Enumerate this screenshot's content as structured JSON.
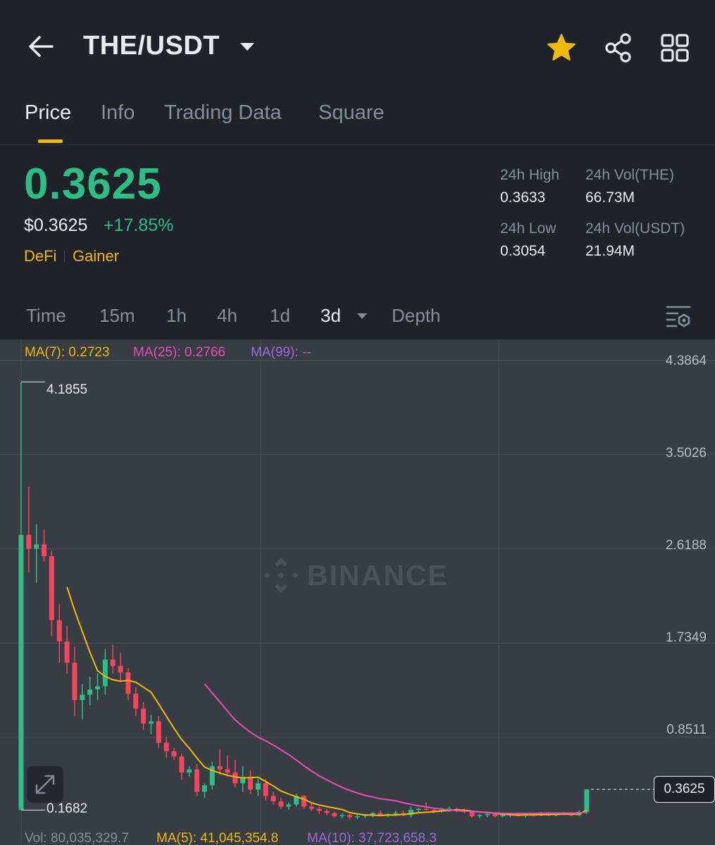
{
  "header": {
    "pair": "THE/USDT",
    "back_icon": "back-arrow-icon",
    "favorite_icon": "star-icon",
    "share_icon": "share-icon",
    "menu_icon": "grid-icon",
    "favorite_color": "#f0b90b"
  },
  "tabs": [
    {
      "label": "Price",
      "active": true
    },
    {
      "label": "Info",
      "active": false
    },
    {
      "label": "Trading Data",
      "active": false
    },
    {
      "label": "Square",
      "active": false
    }
  ],
  "price": {
    "last": "0.3625",
    "usd": "$0.3625",
    "change": "+17.85%",
    "tags": [
      "DeFi",
      "Gainer"
    ],
    "up_color": "#2ebd85",
    "down_color": "#f6465d",
    "accent_color": "#f0b90b"
  },
  "stats": {
    "high_label": "24h High",
    "high": "0.3633",
    "low_label": "24h Low",
    "low": "0.3054",
    "vol_base_label": "24h Vol(THE)",
    "vol_base": "66.73M",
    "vol_quote_label": "24h Vol(USDT)",
    "vol_quote": "21.94M"
  },
  "intervals": {
    "items": [
      "Time",
      "15m",
      "1h",
      "4h",
      "1d",
      "3d",
      "Depth"
    ],
    "active": "3d",
    "settings_icon": "chart-settings-icon"
  },
  "chart": {
    "ma7": "MA(7): 0.2723",
    "ma25": "MA(25): 0.2766",
    "ma99": "MA(99): --",
    "y_ticks": [
      "4.3864",
      "3.5026",
      "2.6188",
      "1.7349",
      "0.8511"
    ],
    "high_marker": "4.1855",
    "low_marker": "0.1682",
    "current_price": "0.3625",
    "watermark": "BINANCE",
    "vol": "Vol: 80,035,329.7",
    "vol_ma5": "MA(5): 41,045,354.8",
    "vol_ma10": "MA(10): 37,723,658.3",
    "ma7_color": "#f0b90b",
    "ma25_color": "#e84dbe",
    "ma99_color": "#9c6ade",
    "expand_icon": "expand-icon"
  },
  "chart_data": {
    "type": "candlestick",
    "y_range": [
      0.0,
      4.3864
    ],
    "y_ticks": [
      4.3864,
      3.5026,
      2.6188,
      1.7349,
      0.8511
    ],
    "grid": true,
    "candles": [
      [
        0.17,
        4.1855,
        0.1682,
        2.75
      ],
      [
        2.75,
        3.2,
        2.4,
        2.62
      ],
      [
        2.62,
        2.85,
        2.3,
        2.66
      ],
      [
        2.66,
        2.8,
        2.5,
        2.55
      ],
      [
        2.55,
        2.6,
        1.8,
        1.95
      ],
      [
        1.95,
        2.1,
        1.55,
        1.75
      ],
      [
        1.75,
        1.9,
        1.45,
        1.55
      ],
      [
        1.55,
        1.7,
        1.05,
        1.2
      ],
      [
        1.2,
        1.35,
        1.02,
        1.25
      ],
      [
        1.25,
        1.42,
        1.15,
        1.3
      ],
      [
        1.3,
        1.45,
        1.2,
        1.33
      ],
      [
        1.33,
        1.68,
        1.25,
        1.58
      ],
      [
        1.58,
        1.72,
        1.45,
        1.52
      ],
      [
        1.52,
        1.64,
        1.38,
        1.46
      ],
      [
        1.46,
        1.5,
        1.2,
        1.26
      ],
      [
        1.26,
        1.32,
        1.05,
        1.12
      ],
      [
        1.12,
        1.18,
        0.92,
        0.98
      ],
      [
        0.98,
        1.06,
        0.88,
        1.0
      ],
      [
        1.0,
        1.05,
        0.75,
        0.8
      ],
      [
        0.8,
        0.85,
        0.66,
        0.72
      ],
      [
        0.72,
        0.75,
        0.64,
        0.67
      ],
      [
        0.67,
        0.7,
        0.45,
        0.52
      ],
      [
        0.52,
        0.58,
        0.48,
        0.55
      ],
      [
        0.55,
        0.6,
        0.3,
        0.34
      ],
      [
        0.34,
        0.42,
        0.28,
        0.4
      ],
      [
        0.4,
        0.62,
        0.36,
        0.58
      ],
      [
        0.58,
        0.74,
        0.5,
        0.55
      ],
      [
        0.55,
        0.68,
        0.48,
        0.52
      ],
      [
        0.52,
        0.64,
        0.38,
        0.42
      ],
      [
        0.42,
        0.58,
        0.34,
        0.48
      ],
      [
        0.48,
        0.54,
        0.32,
        0.36
      ],
      [
        0.36,
        0.46,
        0.3,
        0.42
      ],
      [
        0.42,
        0.46,
        0.26,
        0.3
      ],
      [
        0.3,
        0.34,
        0.22,
        0.25
      ],
      [
        0.25,
        0.28,
        0.18,
        0.2
      ],
      [
        0.2,
        0.24,
        0.17,
        0.22
      ],
      [
        0.22,
        0.32,
        0.2,
        0.3
      ],
      [
        0.3,
        0.31,
        0.18,
        0.2
      ],
      [
        0.2,
        0.23,
        0.16,
        0.18
      ],
      [
        0.18,
        0.2,
        0.13,
        0.16
      ],
      [
        0.16,
        0.18,
        0.12,
        0.14
      ],
      [
        0.14,
        0.15,
        0.1,
        0.11
      ],
      [
        0.11,
        0.14,
        0.09,
        0.12
      ],
      [
        0.12,
        0.13,
        0.08,
        0.1
      ],
      [
        0.1,
        0.12,
        0.08,
        0.11
      ],
      [
        0.11,
        0.13,
        0.09,
        0.12
      ],
      [
        0.12,
        0.15,
        0.1,
        0.14
      ],
      [
        0.14,
        0.16,
        0.11,
        0.12
      ],
      [
        0.12,
        0.14,
        0.1,
        0.13
      ],
      [
        0.13,
        0.16,
        0.11,
        0.14
      ],
      [
        0.14,
        0.16,
        0.11,
        0.12
      ],
      [
        0.12,
        0.2,
        0.1,
        0.17
      ],
      [
        0.17,
        0.19,
        0.14,
        0.18
      ],
      [
        0.18,
        0.24,
        0.16,
        0.17
      ],
      [
        0.17,
        0.19,
        0.14,
        0.16
      ],
      [
        0.16,
        0.19,
        0.14,
        0.17
      ],
      [
        0.17,
        0.2,
        0.15,
        0.18
      ],
      [
        0.18,
        0.19,
        0.15,
        0.16
      ],
      [
        0.16,
        0.18,
        0.14,
        0.15
      ],
      [
        0.15,
        0.16,
        0.1,
        0.11
      ],
      [
        0.11,
        0.13,
        0.09,
        0.12
      ],
      [
        0.12,
        0.14,
        0.1,
        0.13
      ],
      [
        0.13,
        0.14,
        0.1,
        0.11
      ],
      [
        0.11,
        0.13,
        0.1,
        0.12
      ],
      [
        0.12,
        0.14,
        0.1,
        0.13
      ],
      [
        0.13,
        0.14,
        0.11,
        0.12
      ],
      [
        0.12,
        0.14,
        0.1,
        0.13
      ],
      [
        0.13,
        0.14,
        0.11,
        0.12
      ],
      [
        0.12,
        0.15,
        0.11,
        0.14
      ],
      [
        0.14,
        0.15,
        0.11,
        0.12
      ],
      [
        0.12,
        0.14,
        0.11,
        0.13
      ],
      [
        0.13,
        0.15,
        0.12,
        0.14
      ],
      [
        0.14,
        0.15,
        0.11,
        0.12
      ],
      [
        0.12,
        0.16,
        0.11,
        0.15
      ],
      [
        0.15,
        0.3,
        0.13,
        0.3625
      ]
    ],
    "ma7_start": 6,
    "ma25_start": 22
  }
}
